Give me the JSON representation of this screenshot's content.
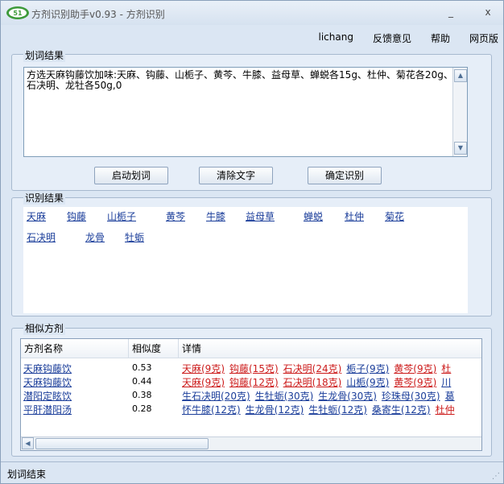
{
  "window": {
    "title": "方剂识别助手v0.93 - 方剂识别",
    "minimize": "_",
    "close": "x"
  },
  "menu": [
    "lichang",
    "反馈意见",
    "帮助",
    "网页版"
  ],
  "segmentation": {
    "group_title": "划词结果",
    "text": "方选天麻钩藤饮加味:天麻、钩藤、山栀子、黄芩、牛膝、益母草、蝉蜕各15g、杜仲、菊花各20g、石决明、龙牡各50g,0",
    "buttons": {
      "start": "启动划词",
      "clear": "清除文字",
      "confirm": "确定识别"
    }
  },
  "recognition": {
    "group_title": "识别结果",
    "row1": [
      "天麻",
      "钩藤",
      "山栀子",
      "黄芩",
      "牛膝",
      "益母草",
      "蝉蜕",
      "杜仲",
      "菊花"
    ],
    "row2": [
      "石决明",
      "龙骨",
      "牡蛎"
    ]
  },
  "similar": {
    "group_title": "相似方剂",
    "headers": {
      "name": "方剂名称",
      "similarity": "相似度",
      "detail": "详情"
    },
    "rows": [
      {
        "name": "天麻钩藤饮",
        "similarity": "0.53",
        "detail": [
          {
            "text": "天麻(9克)",
            "color": "red"
          },
          {
            "text": "钩藤(15克)",
            "color": "red"
          },
          {
            "text": "石决明(24克)",
            "color": "red"
          },
          {
            "text": "栀子(9克)",
            "color": "blue"
          },
          {
            "text": "黄芩(9克)",
            "color": "red"
          },
          {
            "text": "杜",
            "color": "red"
          }
        ]
      },
      {
        "name": "天麻钩藤饮",
        "similarity": "0.44",
        "detail": [
          {
            "text": "天麻(9克)",
            "color": "red"
          },
          {
            "text": "钩藤(12克)",
            "color": "red"
          },
          {
            "text": "石决明(18克)",
            "color": "red"
          },
          {
            "text": "山栀(9克)",
            "color": "blue"
          },
          {
            "text": "黄芩(9克)",
            "color": "red"
          },
          {
            "text": "川",
            "color": "blue"
          }
        ]
      },
      {
        "name": "潜阳定眩饮",
        "similarity": "0.38",
        "detail": [
          {
            "text": "生石决明(20克)",
            "color": "blue"
          },
          {
            "text": "生牡蛎(30克)",
            "color": "blue"
          },
          {
            "text": "生龙骨(30克)",
            "color": "blue"
          },
          {
            "text": "珍珠母(30克)",
            "color": "blue"
          },
          {
            "text": "葛",
            "color": "blue"
          }
        ]
      },
      {
        "name": "平肝潜阳汤",
        "similarity": "0.28",
        "detail": [
          {
            "text": "怀牛膝(12克)",
            "color": "blue"
          },
          {
            "text": "生龙骨(12克)",
            "color": "blue"
          },
          {
            "text": "生牡蛎(12克)",
            "color": "blue"
          },
          {
            "text": "桑寄生(12克)",
            "color": "blue"
          },
          {
            "text": "杜仲",
            "color": "red"
          }
        ]
      }
    ]
  },
  "status": "划词结束"
}
